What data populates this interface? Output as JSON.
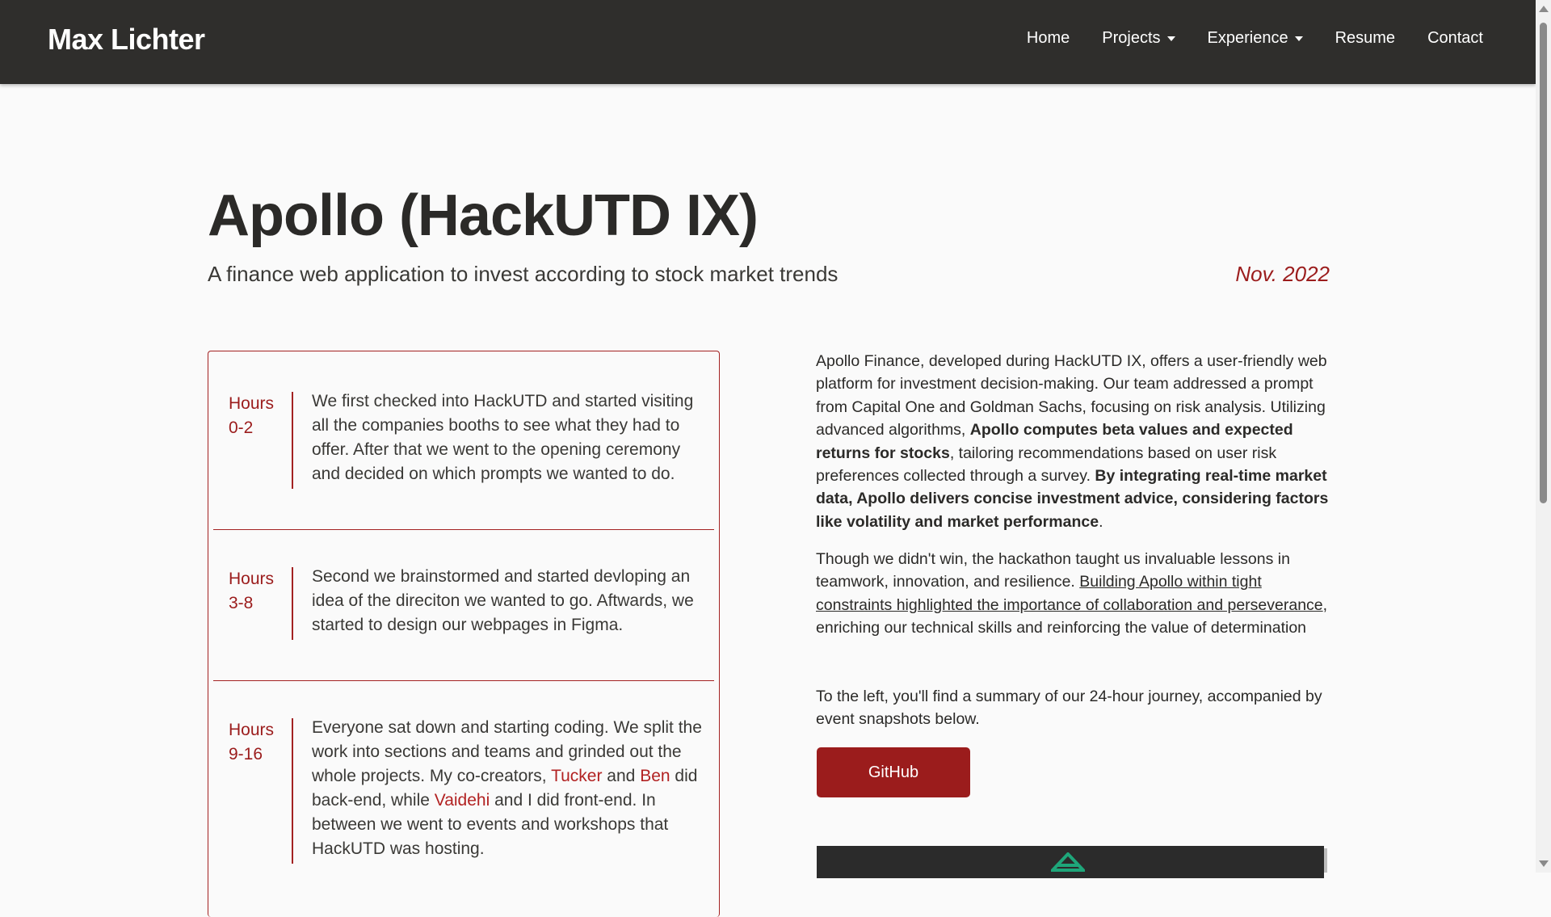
{
  "nav": {
    "brand": "Max Lichter",
    "links": [
      {
        "label": "Home",
        "dropdown": false
      },
      {
        "label": "Projects",
        "dropdown": true
      },
      {
        "label": "Experience",
        "dropdown": true
      },
      {
        "label": "Resume",
        "dropdown": false
      },
      {
        "label": "Contact",
        "dropdown": false
      }
    ]
  },
  "header": {
    "title": "Apollo (HackUTD IX)",
    "subtitle": "A finance web application to invest according to stock market trends",
    "date": "Nov. 2022"
  },
  "timeline": [
    {
      "hours_line1": "Hours",
      "hours_line2": "0-2",
      "text": "We first checked into HackUTD and started visiting all the companies booths to see what they had to offer. After that we went to the opening ceremony and decided on which prompts we wanted to do."
    },
    {
      "hours_line1": "Hours",
      "hours_line2": "3-8",
      "text": "Second we brainstormed and started devloping an idea of the direciton we wanted to go. Aftwards, we started to design our webpages in Figma."
    },
    {
      "hours_line1": "Hours",
      "hours_line2": "9-16",
      "text_part1": "Everyone sat down and starting coding. We split the work into sections and teams and grinded out the whole projects. My co-creators, ",
      "name1": "Tucker",
      "text_part2": " and ",
      "name2": "Ben",
      "text_part3": " did back-end, while ",
      "name3": "Vaidehi",
      "text_part4": " and I did front-end. In between we went to events and workshops that HackUTD was hosting."
    }
  ],
  "description": {
    "p1_a": "Apollo Finance, developed during HackUTD IX, offers a user-friendly web platform for investment decision-making. Our team addressed a prompt from Capital One and Goldman Sachs, focusing on risk analysis. Utilizing advanced algorithms, ",
    "p1_b": "Apollo computes beta values and expected returns for stocks",
    "p1_c": ", tailoring recommendations based on user risk preferences collected through a survey. ",
    "p1_d": "By integrating real-time market data, Apollo delivers concise investment advice, considering factors like volatility and market performance",
    "p1_e": ".",
    "p2_a": "Though we didn't win, the hackathon taught us invaluable lessons in teamwork, innovation, and resilience. ",
    "p2_b": "Building Apollo within tight constraints highlighted the importance of collaboration and perseverance",
    "p2_c": ", enriching our technical skills and reinforcing the value of determination",
    "p3": "To the left, you'll find a summary of our 24-hour journey, accompanied by event snapshots below."
  },
  "github_button": "GitHub",
  "colors": {
    "navbar": "#2f2e2c",
    "accent": "#9b1c1c",
    "background": "#fafafa",
    "logo": "#1ea67a"
  },
  "icons": {
    "dropdown": "caret-down-icon",
    "snapshot_logo": "apollo-logo-icon"
  }
}
